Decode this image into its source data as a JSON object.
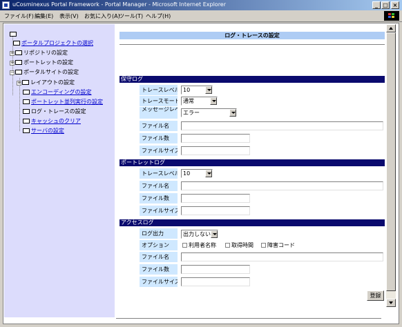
{
  "window": {
    "title": "uCosminexus Portal Framework - Portal Manager - Microsoft Internet Explorer"
  },
  "menu": [
    "ファイル(F)",
    "編集(E)",
    "表示(V)",
    "お気に入り(A)",
    "ツール(T)",
    "ヘルプ(H)"
  ],
  "tree": {
    "items": [
      {
        "label": "ポータルプロジェクトの選択",
        "link": true
      },
      {
        "label": "リポジトリの設定",
        "link": false
      },
      {
        "label": "ポートレットの設定",
        "link": false
      },
      {
        "label": "ポータルサイトの設定",
        "link": false
      },
      {
        "label": "レイアウトの設定",
        "link": false
      },
      {
        "label": "エンコーディングの設定",
        "link": true
      },
      {
        "label": "ポートレット並列実行の設定",
        "link": true
      },
      {
        "label": "ログ・トレースの設定",
        "link": false
      },
      {
        "label": "キャッシュのクリア",
        "link": true
      },
      {
        "label": "サーバの設定",
        "link": true
      }
    ]
  },
  "page": {
    "title": "ログ・トレースの設定",
    "register_button": "登録"
  },
  "sections": {
    "maintenance": {
      "title": "保守ログ",
      "trace_level_label": "トレースレベル",
      "trace_level_value": "10",
      "trace_mode_label": "トレースモード",
      "trace_mode_value": "通常",
      "message_level_label": "メッセージレベル",
      "message_level_value": "エラー",
      "file_name_label": "ファイル名",
      "file_name_value": "",
      "file_count_label": "ファイル数",
      "file_count_value": "",
      "file_size_label": "ファイルサイズ",
      "file_size_value": ""
    },
    "portlet": {
      "title": "ポートレットログ",
      "trace_level_label": "トレースレベル",
      "trace_level_value": "10",
      "file_name_label": "ファイル名",
      "file_name_value": "",
      "file_count_label": "ファイル数",
      "file_count_value": "",
      "file_size_label": "ファイルサイズ",
      "file_size_value": ""
    },
    "access": {
      "title": "アクセスログ",
      "log_output_label": "ログ出力",
      "log_output_value": "出力しない",
      "options_label": "オプション",
      "options": [
        {
          "label": "利用者名称",
          "checked": false
        },
        {
          "label": "取得時間",
          "checked": false
        },
        {
          "label": "障害コード",
          "checked": false
        }
      ],
      "file_name_label": "ファイル名",
      "file_name_value": "",
      "file_count_label": "ファイル数",
      "file_count_value": "",
      "file_size_label": "ファイルサイズ",
      "file_size_value": ""
    }
  }
}
